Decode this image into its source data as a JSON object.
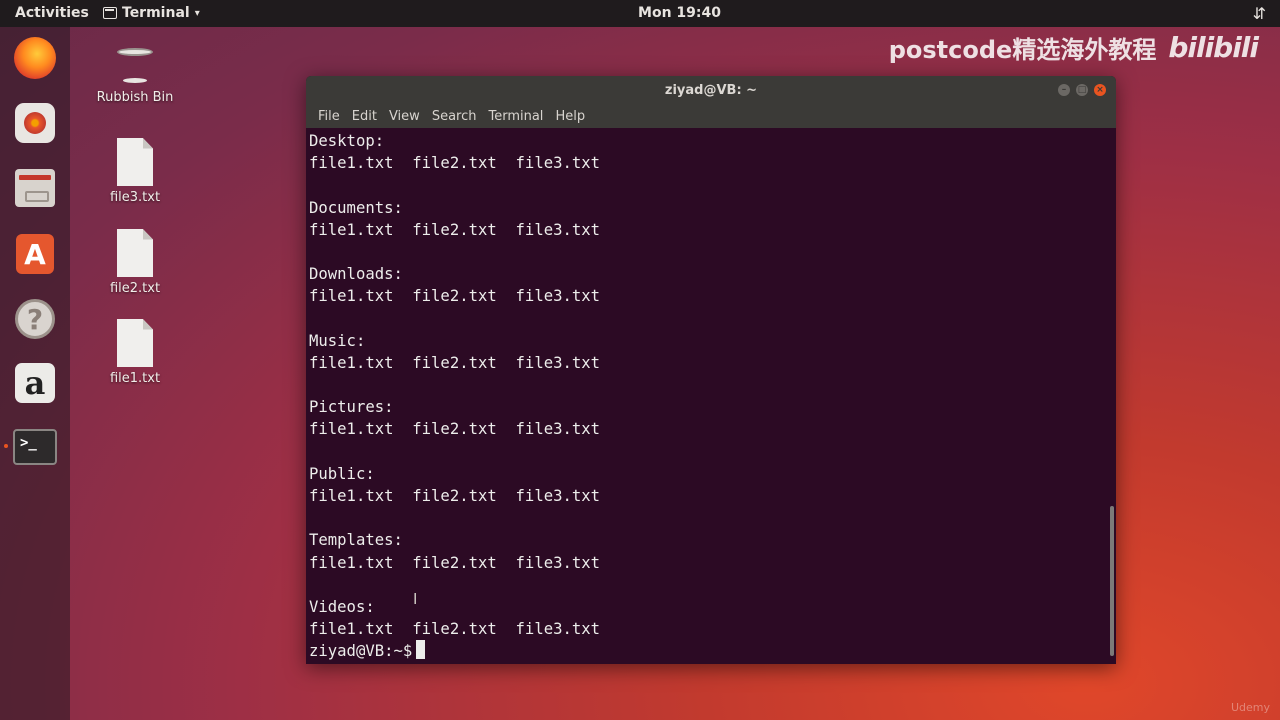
{
  "topbar": {
    "activities": "Activities",
    "app_name": "Terminal",
    "app_caret": "▾",
    "clock": "Mon 19:40",
    "tray_icon": "⇵"
  },
  "dock": {
    "items": [
      "firefox-icon",
      "rhythmbox-icon",
      "files-icon",
      "software-store-icon",
      "help-icon",
      "amazon-icon",
      "terminal-icon"
    ],
    "store_glyph": "A",
    "help_glyph": "?",
    "amazon_glyph": "a",
    "terminal_glyph": ">_"
  },
  "desktop": {
    "icons": [
      {
        "label": "Rubbish Bin"
      },
      {
        "label": "file3.txt"
      },
      {
        "label": "file2.txt"
      },
      {
        "label": "file1.txt"
      }
    ]
  },
  "watermark": {
    "text": "postcode精选海外教程",
    "brand": "bilibili",
    "corner": "Udemy"
  },
  "window": {
    "title": "ziyad@VB: ~",
    "controls": [
      "–",
      "□",
      "×"
    ],
    "menu": [
      "File",
      "Edit",
      "View",
      "Search",
      "Terminal",
      "Help"
    ],
    "lines": [
      "Desktop:",
      "file1.txt  file2.txt  file3.txt",
      "",
      "Documents:",
      "file1.txt  file2.txt  file3.txt",
      "",
      "Downloads:",
      "file1.txt  file2.txt  file3.txt",
      "",
      "Music:",
      "file1.txt  file2.txt  file3.txt",
      "",
      "Pictures:",
      "file1.txt  file2.txt  file3.txt",
      "",
      "Public:",
      "file1.txt  file2.txt  file3.txt",
      "",
      "Templates:",
      "file1.txt  file2.txt  file3.txt",
      "",
      "Videos:",
      "file1.txt  file2.txt  file3.txt"
    ],
    "prompt": "ziyad@VB:~$"
  }
}
